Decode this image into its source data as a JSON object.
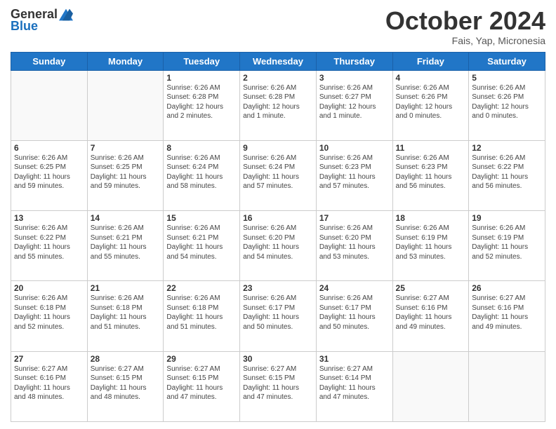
{
  "header": {
    "logo": {
      "general": "General",
      "blue": "Blue"
    },
    "title": "October 2024",
    "subtitle": "Fais, Yap, Micronesia"
  },
  "calendar": {
    "days_of_week": [
      "Sunday",
      "Monday",
      "Tuesday",
      "Wednesday",
      "Thursday",
      "Friday",
      "Saturday"
    ],
    "weeks": [
      [
        {
          "day": "",
          "info": ""
        },
        {
          "day": "",
          "info": ""
        },
        {
          "day": "1",
          "info": "Sunrise: 6:26 AM\nSunset: 6:28 PM\nDaylight: 12 hours\nand 2 minutes."
        },
        {
          "day": "2",
          "info": "Sunrise: 6:26 AM\nSunset: 6:28 PM\nDaylight: 12 hours\nand 1 minute."
        },
        {
          "day": "3",
          "info": "Sunrise: 6:26 AM\nSunset: 6:27 PM\nDaylight: 12 hours\nand 1 minute."
        },
        {
          "day": "4",
          "info": "Sunrise: 6:26 AM\nSunset: 6:26 PM\nDaylight: 12 hours\nand 0 minutes."
        },
        {
          "day": "5",
          "info": "Sunrise: 6:26 AM\nSunset: 6:26 PM\nDaylight: 12 hours\nand 0 minutes."
        }
      ],
      [
        {
          "day": "6",
          "info": "Sunrise: 6:26 AM\nSunset: 6:25 PM\nDaylight: 11 hours\nand 59 minutes."
        },
        {
          "day": "7",
          "info": "Sunrise: 6:26 AM\nSunset: 6:25 PM\nDaylight: 11 hours\nand 59 minutes."
        },
        {
          "day": "8",
          "info": "Sunrise: 6:26 AM\nSunset: 6:24 PM\nDaylight: 11 hours\nand 58 minutes."
        },
        {
          "day": "9",
          "info": "Sunrise: 6:26 AM\nSunset: 6:24 PM\nDaylight: 11 hours\nand 57 minutes."
        },
        {
          "day": "10",
          "info": "Sunrise: 6:26 AM\nSunset: 6:23 PM\nDaylight: 11 hours\nand 57 minutes."
        },
        {
          "day": "11",
          "info": "Sunrise: 6:26 AM\nSunset: 6:23 PM\nDaylight: 11 hours\nand 56 minutes."
        },
        {
          "day": "12",
          "info": "Sunrise: 6:26 AM\nSunset: 6:22 PM\nDaylight: 11 hours\nand 56 minutes."
        }
      ],
      [
        {
          "day": "13",
          "info": "Sunrise: 6:26 AM\nSunset: 6:22 PM\nDaylight: 11 hours\nand 55 minutes."
        },
        {
          "day": "14",
          "info": "Sunrise: 6:26 AM\nSunset: 6:21 PM\nDaylight: 11 hours\nand 55 minutes."
        },
        {
          "day": "15",
          "info": "Sunrise: 6:26 AM\nSunset: 6:21 PM\nDaylight: 11 hours\nand 54 minutes."
        },
        {
          "day": "16",
          "info": "Sunrise: 6:26 AM\nSunset: 6:20 PM\nDaylight: 11 hours\nand 54 minutes."
        },
        {
          "day": "17",
          "info": "Sunrise: 6:26 AM\nSunset: 6:20 PM\nDaylight: 11 hours\nand 53 minutes."
        },
        {
          "day": "18",
          "info": "Sunrise: 6:26 AM\nSunset: 6:19 PM\nDaylight: 11 hours\nand 53 minutes."
        },
        {
          "day": "19",
          "info": "Sunrise: 6:26 AM\nSunset: 6:19 PM\nDaylight: 11 hours\nand 52 minutes."
        }
      ],
      [
        {
          "day": "20",
          "info": "Sunrise: 6:26 AM\nSunset: 6:18 PM\nDaylight: 11 hours\nand 52 minutes."
        },
        {
          "day": "21",
          "info": "Sunrise: 6:26 AM\nSunset: 6:18 PM\nDaylight: 11 hours\nand 51 minutes."
        },
        {
          "day": "22",
          "info": "Sunrise: 6:26 AM\nSunset: 6:18 PM\nDaylight: 11 hours\nand 51 minutes."
        },
        {
          "day": "23",
          "info": "Sunrise: 6:26 AM\nSunset: 6:17 PM\nDaylight: 11 hours\nand 50 minutes."
        },
        {
          "day": "24",
          "info": "Sunrise: 6:26 AM\nSunset: 6:17 PM\nDaylight: 11 hours\nand 50 minutes."
        },
        {
          "day": "25",
          "info": "Sunrise: 6:27 AM\nSunset: 6:16 PM\nDaylight: 11 hours\nand 49 minutes."
        },
        {
          "day": "26",
          "info": "Sunrise: 6:27 AM\nSunset: 6:16 PM\nDaylight: 11 hours\nand 49 minutes."
        }
      ],
      [
        {
          "day": "27",
          "info": "Sunrise: 6:27 AM\nSunset: 6:16 PM\nDaylight: 11 hours\nand 48 minutes."
        },
        {
          "day": "28",
          "info": "Sunrise: 6:27 AM\nSunset: 6:15 PM\nDaylight: 11 hours\nand 48 minutes."
        },
        {
          "day": "29",
          "info": "Sunrise: 6:27 AM\nSunset: 6:15 PM\nDaylight: 11 hours\nand 47 minutes."
        },
        {
          "day": "30",
          "info": "Sunrise: 6:27 AM\nSunset: 6:15 PM\nDaylight: 11 hours\nand 47 minutes."
        },
        {
          "day": "31",
          "info": "Sunrise: 6:27 AM\nSunset: 6:14 PM\nDaylight: 11 hours\nand 47 minutes."
        },
        {
          "day": "",
          "info": ""
        },
        {
          "day": "",
          "info": ""
        }
      ]
    ]
  }
}
